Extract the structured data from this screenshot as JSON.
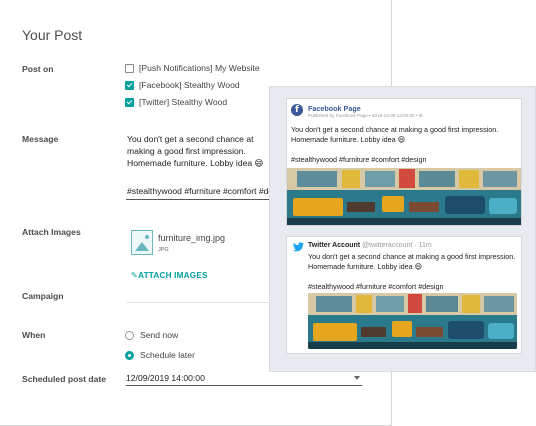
{
  "form": {
    "title": "Your Post",
    "labels": {
      "post_on": "Post on",
      "message": "Message",
      "attach_images": "Attach Images",
      "campaign": "Campaign",
      "when": "When",
      "scheduled_post_date": "Scheduled post date"
    },
    "accounts": [
      {
        "label": "[Push Notifications] My Website",
        "checked": false
      },
      {
        "label": "[Facebook] Stealthy Wood",
        "checked": true
      },
      {
        "label": "[Twitter] Stealthy Wood",
        "checked": true
      }
    ],
    "message_text": "You don't get a second chance at making a good first impression. Homemade furniture. Lobby idea 😄",
    "message_tags": "#stealthywood #furniture #comfort #design",
    "attachment": {
      "name": "furniture_img.jpg",
      "type": "JPG"
    },
    "attach_button": "ATTACH IMAGES",
    "campaign_value": "",
    "when_options": [
      {
        "label": "Send now",
        "selected": false
      },
      {
        "label": "Schedule later",
        "selected": true
      }
    ],
    "scheduled_date": "12/09/2019 14:00:00"
  },
  "preview": {
    "facebook": {
      "page_name": "Facebook Page",
      "meta": "Published by Facebook Page • 2019-12-09 13:00:00 • ⊕",
      "text": "You don't get a second chance at making a good first impression. Homemade furniture. Lobby idea 😄",
      "tags": "#stealthywood #furniture #comfort #design"
    },
    "twitter": {
      "account_name": "Twitter Account",
      "handle_time": "@twitteraccount · 11m",
      "text": "You don't get a second chance at making a good first impression. Homemade furniture. Lobby idea 😄",
      "tags": "#stealthywood #furniture #comfort #design"
    }
  },
  "colors": {
    "accent": "#00a09d",
    "facebook": "#3b5998",
    "twitter": "#1da1f2"
  }
}
